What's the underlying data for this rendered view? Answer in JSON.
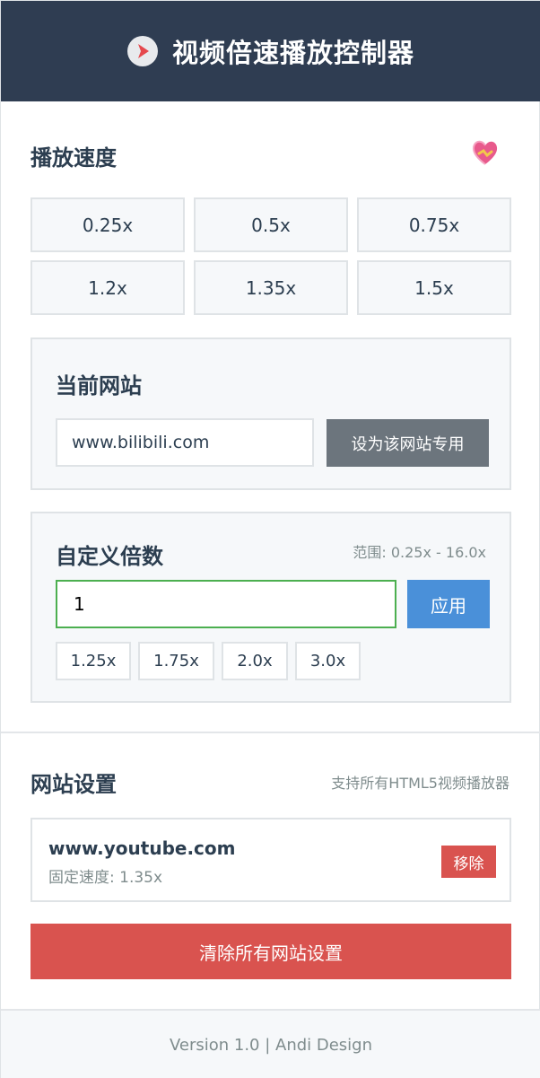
{
  "header": {
    "title": "视频倍速播放控制器",
    "logo_icon": "play-icon"
  },
  "speed": {
    "title": "播放速度",
    "presets": [
      "0.25x",
      "0.5x",
      "0.75x",
      "1.2x",
      "1.35x",
      "1.5x"
    ]
  },
  "current_site": {
    "title": "当前网站",
    "value": "www.bilibili.com",
    "button_label": "设为该网站专用"
  },
  "custom": {
    "title": "自定义倍数",
    "range": "范围: 0.25x - 16.0x",
    "value": "1",
    "apply_label": "应用",
    "presets": [
      "1.25x",
      "1.75x",
      "2.0x",
      "3.0x"
    ]
  },
  "site_settings": {
    "title": "网站设置",
    "support": "支持所有HTML5视频播放器",
    "items": [
      {
        "name": "www.youtube.com",
        "speed": "固定速度: 1.35x",
        "remove_label": "移除"
      }
    ],
    "clear_label": "清除所有网站设置"
  },
  "footer": {
    "text": "Version 1.0 | Andi Design"
  },
  "colors": {
    "header_bg": "#2f3d52",
    "accent_blue": "#4a90d9",
    "danger_red": "#d9534f",
    "input_focus_green": "#4caf50",
    "secondary_gray": "#6c757d"
  }
}
